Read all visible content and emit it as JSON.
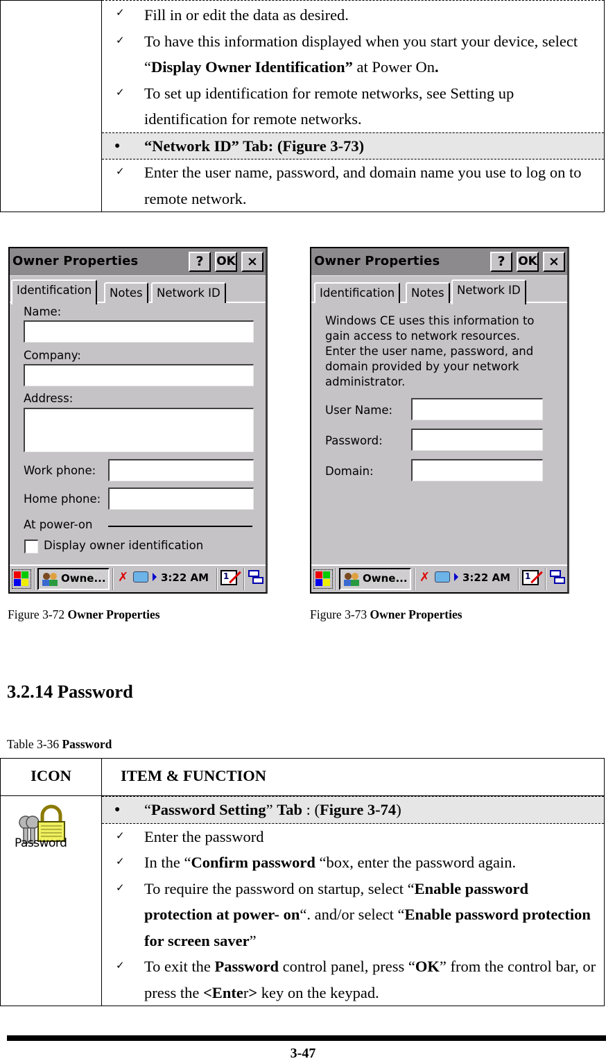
{
  "top_table": {
    "rows": [
      {
        "type": "check",
        "parts": [
          {
            "t": "Fill in or edit the data as desired."
          }
        ]
      },
      {
        "type": "check",
        "parts": [
          {
            "t": "To have this information displayed when you start your device, select “"
          },
          {
            "t": "Display Owner Identification”",
            "b": true
          },
          {
            "t": " at Power On"
          },
          {
            "t": ".",
            "b": true
          }
        ]
      },
      {
        "type": "check",
        "parts": [
          {
            "t": "To set up identification for remote networks, see Setting up identification for remote networks."
          }
        ]
      },
      {
        "type": "bullet",
        "parts": [
          {
            "t": "“Network ID” Tab: (Figure 3-73)",
            "b": true
          }
        ]
      },
      {
        "type": "check",
        "parts": [
          {
            "t": "Enter the user name, password, and domain name you use to log on to remote network."
          }
        ]
      }
    ],
    "check_glyph": "✓",
    "bullet_glyph": "●"
  },
  "figure_72": {
    "window_title": "Owner Properties",
    "buttons": {
      "help": "?",
      "ok": "OK",
      "close": "×"
    },
    "tabs": [
      "Identification",
      "Notes",
      "Network ID"
    ],
    "active_tab": "Identification",
    "fields": {
      "name_label": "Name:",
      "name_value": "",
      "company_label": "Company:",
      "company_value": "",
      "address_label": "Address:",
      "address_value": "",
      "work_phone_label": "Work phone:",
      "work_phone_value": "",
      "home_phone_label": "Home phone:",
      "home_phone_value": ""
    },
    "power_on_group": "At power-on",
    "checkbox_label": "Display owner identification",
    "checkbox_checked": false,
    "caption_prefix": "Figure 3-72 ",
    "caption_bold": "Owner Properties"
  },
  "figure_73": {
    "window_title": "Owner Properties",
    "buttons": {
      "help": "?",
      "ok": "OK",
      "close": "×"
    },
    "tabs": [
      "Identification",
      "Notes",
      "Network ID"
    ],
    "active_tab": "Network ID",
    "description_lines": [
      "Windows CE uses this information to",
      "gain access to network resources.",
      "Enter the user name, password, and",
      "domain provided by your network",
      "administrator."
    ],
    "fields": {
      "user_name_label": "User Name:",
      "user_name_value": "",
      "password_label": "Password:",
      "password_value": "",
      "domain_label": "Domain:",
      "domain_value": ""
    },
    "caption_prefix": "Figure 3-73 ",
    "caption_bold": "Owner Properties"
  },
  "taskbar": {
    "task_label": "Owne...",
    "clock": "3:22 AM",
    "input_glyph": "1"
  },
  "section": {
    "heading": "3.2.14 Password",
    "table_caption_prefix": "Table 3-36 ",
    "table_caption_bold": "Password"
  },
  "password_table": {
    "headers": [
      "ICON",
      "ITEM & FUNCTION"
    ],
    "icon_label": "Password",
    "rows": [
      {
        "type": "bullet",
        "parts": [
          {
            "t": "“"
          },
          {
            "t": "Password Setting",
            "b": true
          },
          {
            "t": "” "
          },
          {
            "t": "Tab",
            "b": true
          },
          {
            "t": " : ("
          },
          {
            "t": "Figure 3-74",
            "b": true
          },
          {
            "t": ")"
          }
        ]
      },
      {
        "type": "check",
        "parts": [
          {
            "t": "Enter the password"
          }
        ]
      },
      {
        "type": "check",
        "parts": [
          {
            "t": "In the “"
          },
          {
            "t": "Confirm password",
            "b": true
          },
          {
            "t": " “box, enter the password again."
          }
        ]
      },
      {
        "type": "check",
        "parts": [
          {
            "t": "To require the password on startup, select “"
          },
          {
            "t": "Enable password protection at power- on",
            "b": true
          },
          {
            "t": "“. and/or select “"
          },
          {
            "t": "Enable password protection for screen saver",
            "b": true
          },
          {
            "t": "”"
          }
        ]
      },
      {
        "type": "check",
        "parts": [
          {
            "t": "To exit the "
          },
          {
            "t": "Password",
            "b": true
          },
          {
            "t": " control panel, press “"
          },
          {
            "t": "OK",
            "b": true
          },
          {
            "t": "” from the control bar, or press the "
          },
          {
            "t": "<Ente",
            "b": true
          },
          {
            "t": "r"
          },
          {
            "t": ">",
            "b": true
          },
          {
            "t": " key on the keypad."
          }
        ]
      }
    ]
  },
  "footer": {
    "page_number": "3-47"
  }
}
